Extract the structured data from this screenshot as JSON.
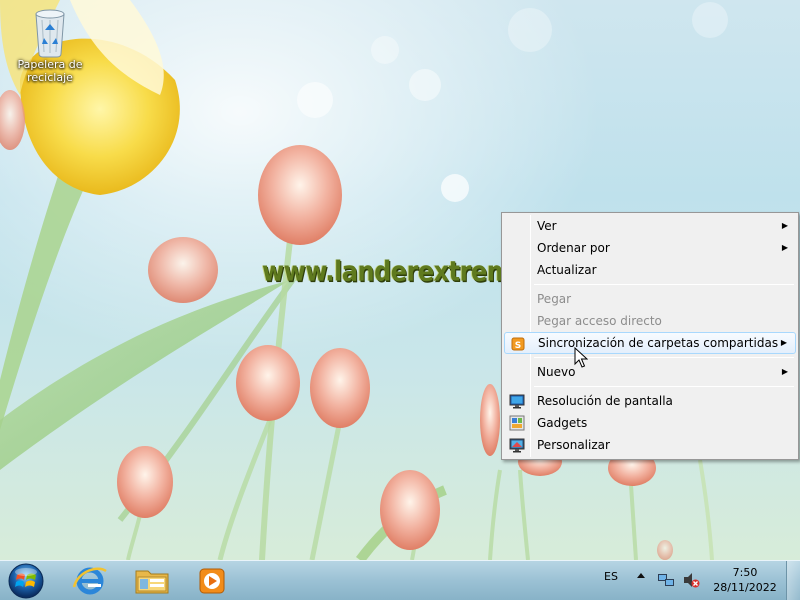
{
  "desktop": {
    "recycle_bin_label": "Papelera de reciclaje",
    "watermark_text": "www.landerextremo.com"
  },
  "context_menu": {
    "items": [
      {
        "label": "Ver",
        "submenu": true,
        "enabled": true
      },
      {
        "label": "Ordenar por",
        "submenu": true,
        "enabled": true
      },
      {
        "label": "Actualizar",
        "submenu": false,
        "enabled": true
      },
      {
        "label": "Pegar",
        "submenu": false,
        "enabled": false
      },
      {
        "label": "Pegar acceso directo",
        "submenu": false,
        "enabled": false
      },
      {
        "label": "Sincronización de carpetas compartidas",
        "submenu": true,
        "enabled": true,
        "highlighted": true,
        "icon": "sync-icon"
      },
      {
        "label": "Nuevo",
        "submenu": true,
        "enabled": true
      },
      {
        "label": "Resolución de pantalla",
        "submenu": false,
        "enabled": true,
        "icon": "display-icon"
      },
      {
        "label": "Gadgets",
        "submenu": false,
        "enabled": true,
        "icon": "gadgets-icon"
      },
      {
        "label": "Personalizar",
        "submenu": false,
        "enabled": true,
        "icon": "personalize-icon"
      }
    ]
  },
  "taskbar": {
    "pinned": [
      "start-orb-icon",
      "internet-explorer-icon",
      "file-explorer-icon",
      "media-player-icon"
    ],
    "language": "ES",
    "time": "7:50",
    "date": "28/11/2022"
  },
  "colors": {
    "menu_bg": "#f0f0f0",
    "menu_highlight_border": "#a8d8fd",
    "taskbar": "#9dc4d8"
  }
}
